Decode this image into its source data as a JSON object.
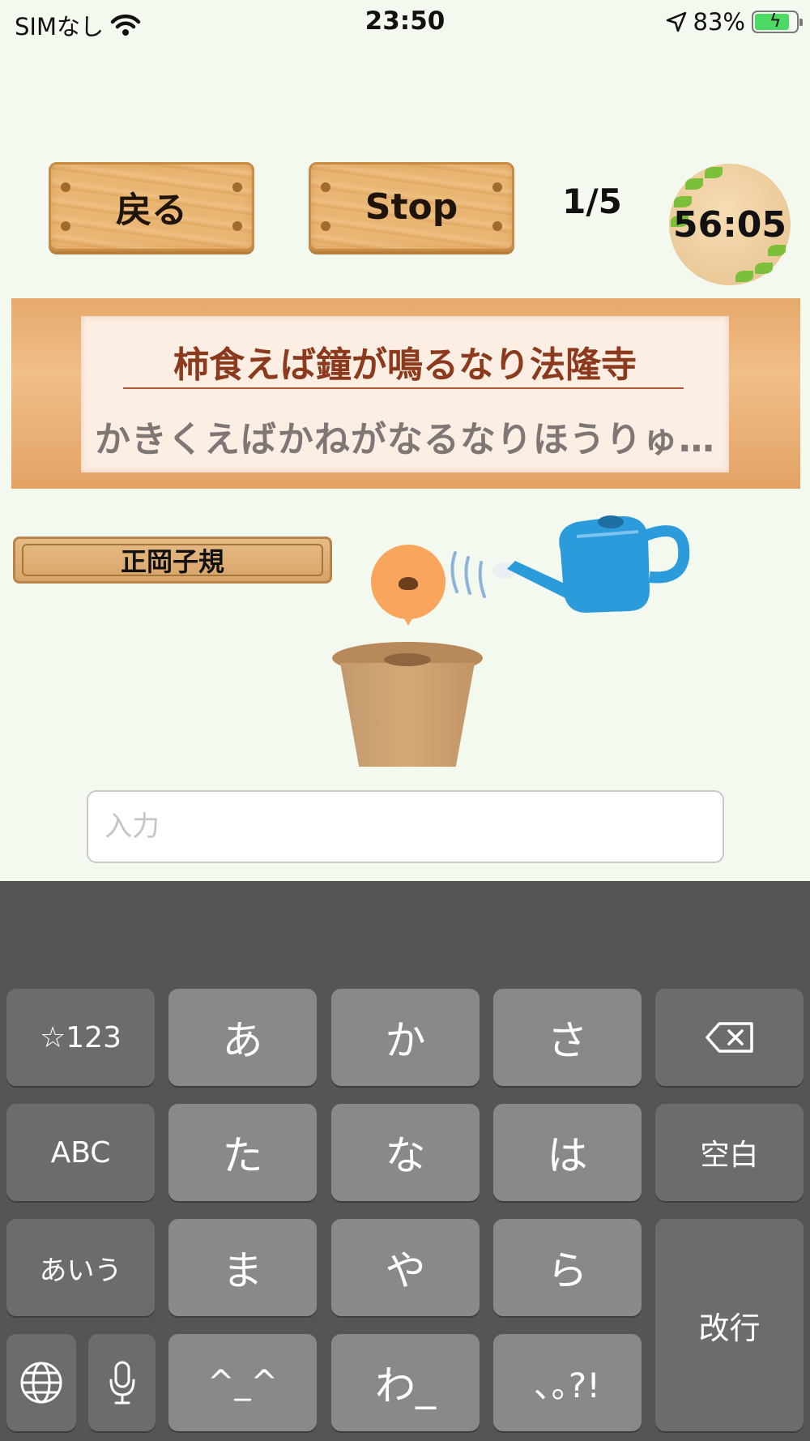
{
  "status_bar": {
    "carrier": "SIMなし",
    "time": "23:50",
    "battery_percent": "83%",
    "battery_level": 0.83
  },
  "toolbar": {
    "back_label": "戻る",
    "stop_label": "Stop",
    "progress": "1/5",
    "timer": "56:05"
  },
  "question": {
    "text": "柿食えば鐘が鳴るなり法隆寺",
    "reading": "かきくえばかねがなるなりほうりゅ…"
  },
  "author": "正岡子規",
  "input": {
    "placeholder": "入力",
    "value": ""
  },
  "keyboard": {
    "row1": {
      "mode_key": "☆123",
      "k1": "あ",
      "k2": "か",
      "k3": "さ"
    },
    "row2": {
      "mode_key": "ABC",
      "k1": "た",
      "k2": "な",
      "k3": "は",
      "space": "空白"
    },
    "row3": {
      "mode_key": "あいう",
      "k1": "ま",
      "k2": "や",
      "k3": "ら",
      "return": "改行"
    },
    "row4": {
      "k0": "^_^",
      "k1": "わ_",
      "k2": "､｡?!"
    }
  }
}
